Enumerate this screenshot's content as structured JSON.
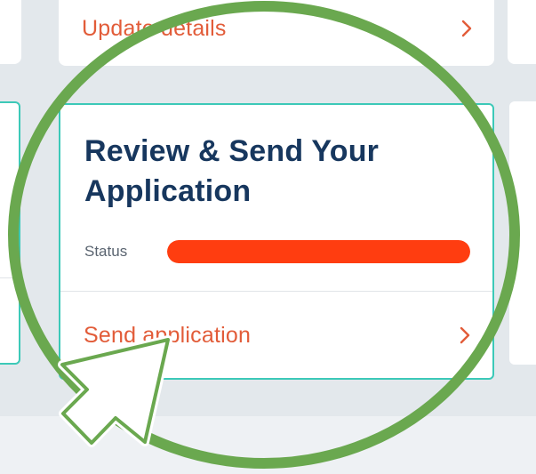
{
  "top_card": {
    "link_label": "Update details",
    "chevron_icon": "chevron-right-icon"
  },
  "review_card": {
    "title": "Review & Send Your Application",
    "status_label": "Status",
    "status_progress_percent": 100,
    "link_label": "Send application",
    "chevron_icon": "chevron-right-icon"
  },
  "annotation": {
    "circle_icon": "highlight-circle",
    "pointer_icon": "arrow-pointer-icon"
  },
  "colors": {
    "accent_link": "#e25c39",
    "title": "#17375e",
    "progress": "#ff3d10",
    "card_border": "#3cc9b8",
    "highlight": "#6aa84f"
  }
}
